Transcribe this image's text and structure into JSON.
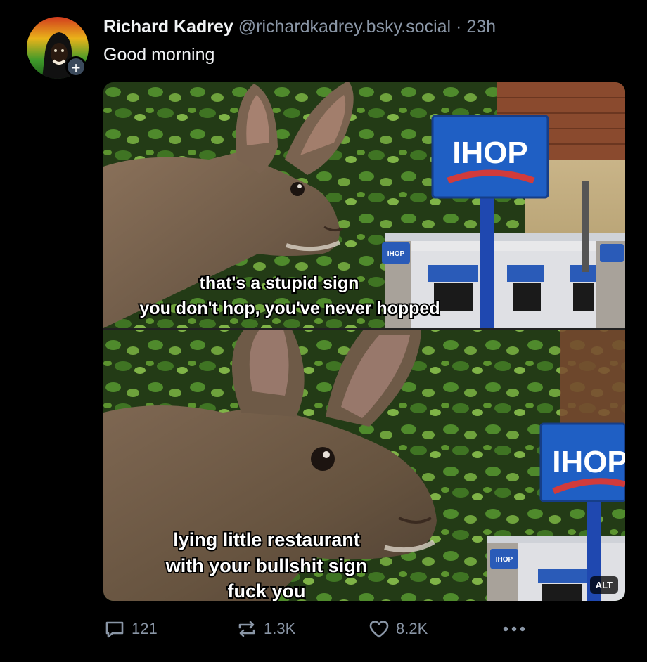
{
  "post": {
    "author_name": "Richard Kadrey",
    "handle": "@richardkadrey.bsky.social",
    "separator": "·",
    "time": "23h",
    "text": "Good morning"
  },
  "avatar": {
    "follow_badge": "+"
  },
  "media": {
    "alt_label": "ALT",
    "top_panel": {
      "sign_text": "IHOP",
      "small_sign_text": "IHOP",
      "caption_lines": [
        "that's a stupid sign",
        "you don't hop, you've never hopped"
      ]
    },
    "bottom_panel": {
      "sign_text": "IHOP",
      "small_sign_text": "IHOP",
      "caption_lines": [
        "lying little restaurant",
        "with your bullshit sign",
        "fuck you"
      ]
    }
  },
  "actions": {
    "reply_count": "121",
    "repost_count": "1.3K",
    "like_count": "8.2K",
    "more_icon": "ellipsis-icon"
  },
  "colors": {
    "background": "#000000",
    "muted": "#8a96a6",
    "text": "#f1f3f5",
    "ihop_blue": "#1f5fc4"
  }
}
